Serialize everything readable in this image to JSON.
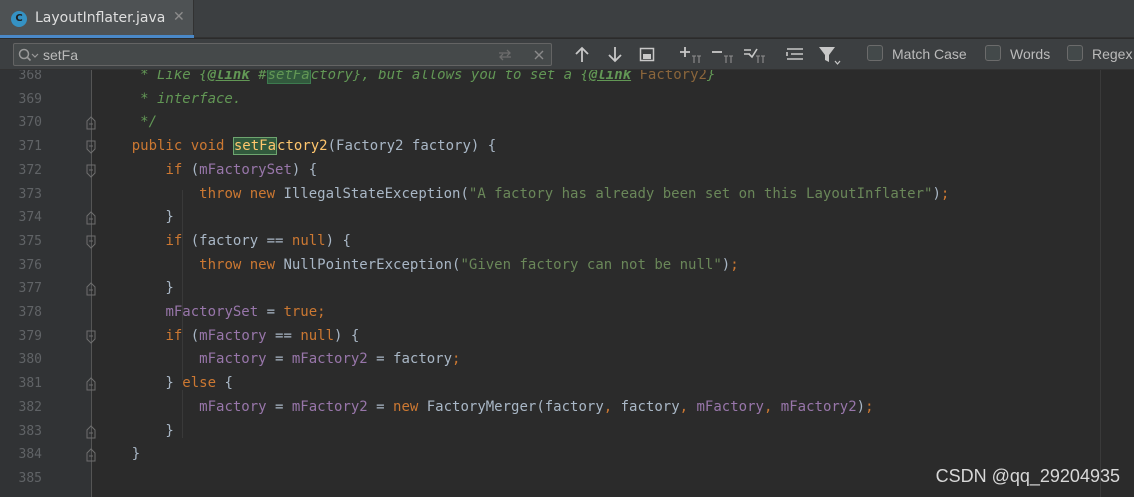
{
  "tab": {
    "title": "LayoutInflater.java",
    "icon_letter": "C",
    "close_glyph": "✕"
  },
  "search": {
    "query": "setFa",
    "options": [
      {
        "label": "Match Case",
        "checked": false
      },
      {
        "label": "Words",
        "checked": false
      },
      {
        "label": "Regex",
        "checked": false
      }
    ]
  },
  "lines": [
    {
      "num": "368",
      "text": "     * Like {@link #setFactory}, but allows you to set a {@link Factory2}"
    },
    {
      "num": "369",
      "text": "     * interface."
    },
    {
      "num": "370",
      "text": "     */"
    },
    {
      "num": "371",
      "text": "    public void setFactory2(Factory2 factory) {"
    },
    {
      "num": "372",
      "text": "        if (mFactorySet) {"
    },
    {
      "num": "373",
      "text": "            throw new IllegalStateException(\"A factory has already been set on this LayoutInflater\");"
    },
    {
      "num": "374",
      "text": "        }"
    },
    {
      "num": "375",
      "text": "        if (factory == null) {"
    },
    {
      "num": "376",
      "text": "            throw new NullPointerException(\"Given factory can not be null\");"
    },
    {
      "num": "377",
      "text": "        }"
    },
    {
      "num": "378",
      "text": "        mFactorySet = true;"
    },
    {
      "num": "379",
      "text": "        if (mFactory == null) {"
    },
    {
      "num": "380",
      "text": "            mFactory = mFactory2 = factory;"
    },
    {
      "num": "381",
      "text": "        } else {"
    },
    {
      "num": "382",
      "text": "            mFactory = mFactory2 = new FactoryMerger(factory, factory, mFactory, mFactory2);"
    },
    {
      "num": "383",
      "text": "        }"
    },
    {
      "num": "384",
      "text": "    }"
    },
    {
      "num": "385",
      "text": ""
    }
  ],
  "watermark": "CSDN @qq_29204935",
  "colors": {
    "keyword": "#cc7832",
    "string": "#6a8759",
    "field": "#9876aa",
    "method": "#ffc66d",
    "comment": "#629755",
    "search_hit": "#32593d"
  }
}
